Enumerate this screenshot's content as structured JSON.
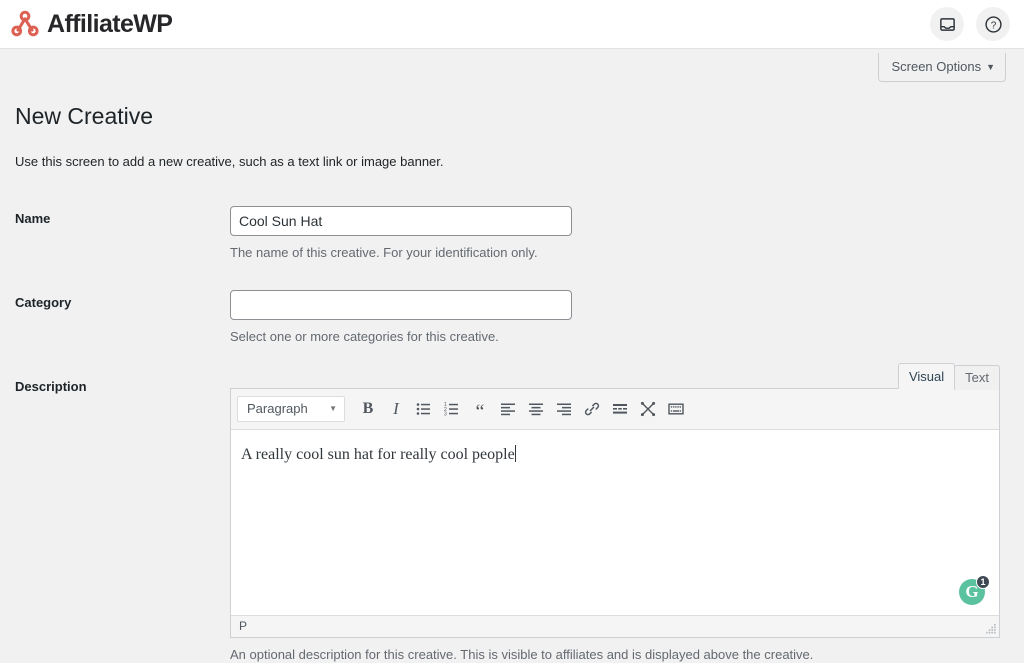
{
  "header": {
    "brand_name": "AffiliateWP",
    "brand_color": "#dd6153",
    "actions": [
      {
        "name": "inbox-button",
        "icon": "inbox-icon"
      },
      {
        "name": "help-button",
        "icon": "question-mark-icon"
      }
    ]
  },
  "screen_options": {
    "label": "Screen Options",
    "caret": "▼"
  },
  "page": {
    "title": "New Creative",
    "subtitle": "Use this screen to add a new creative, such as a text link or image banner."
  },
  "form": {
    "name_field": {
      "label": "Name",
      "value": "Cool Sun Hat",
      "placeholder": "",
      "help": "The name of this creative. For your identification only."
    },
    "category_field": {
      "label": "Category",
      "value": "",
      "placeholder": "",
      "help": "Select one or more categories for this creative."
    },
    "description_field": {
      "label": "Description",
      "help": "An optional description for this creative. This is visible to affiliates and is displayed above the creative."
    }
  },
  "editor": {
    "tabs": [
      {
        "label": "Visual",
        "active": true
      },
      {
        "label": "Text",
        "active": false
      }
    ],
    "format_select": {
      "value": "Paragraph",
      "caret": "▼"
    },
    "toolbar_buttons": [
      {
        "name": "bold-button",
        "label": "B",
        "icon": "bold-icon"
      },
      {
        "name": "italic-button",
        "label": "I",
        "icon": "italic-icon"
      },
      {
        "name": "bulleted-list-button",
        "label": "",
        "icon": "bulleted-list-icon"
      },
      {
        "name": "numbered-list-button",
        "label": "",
        "icon": "numbered-list-icon"
      },
      {
        "name": "blockquote-button",
        "label": "“",
        "icon": "blockquote-icon"
      },
      {
        "name": "align-left-button",
        "label": "",
        "icon": "align-left-icon"
      },
      {
        "name": "align-center-button",
        "label": "",
        "icon": "align-center-icon"
      },
      {
        "name": "align-right-button",
        "label": "",
        "icon": "align-right-icon"
      },
      {
        "name": "insert-link-button",
        "label": "",
        "icon": "link-icon"
      },
      {
        "name": "read-more-button",
        "label": "",
        "icon": "insert-read-more-icon"
      },
      {
        "name": "fullscreen-button",
        "label": "",
        "icon": "distraction-free-icon"
      },
      {
        "name": "toolbar-toggle-button",
        "label": "",
        "icon": "keyboard-toolbar-icon"
      }
    ],
    "content": "A really cool sun hat for really cool people",
    "statusbar_path": "P",
    "grammarly": {
      "letter": "G",
      "count": "1",
      "color": "#5bc2a0"
    }
  }
}
